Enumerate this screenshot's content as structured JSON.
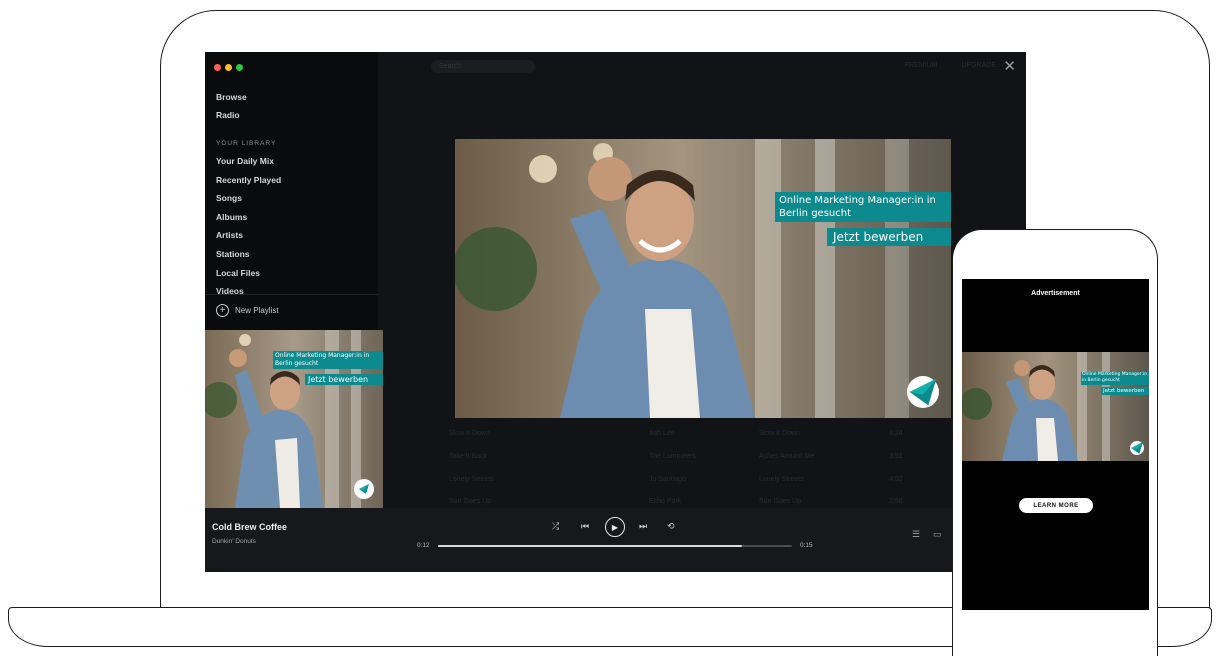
{
  "window": {
    "dots": [
      "#ff5f57",
      "#febc2e",
      "#28c840"
    ]
  },
  "topbar": {
    "search": "Search",
    "user_left": "PREMIUM",
    "user_right": "UPGRADE",
    "close_icon": "✕"
  },
  "sidebar": {
    "nav": [
      {
        "label": "Browse"
      },
      {
        "label": "Radio"
      }
    ],
    "section_label": "YOUR LIBRARY",
    "library": [
      {
        "label": "Your Daily Mix"
      },
      {
        "label": "Recently Played"
      },
      {
        "label": "Songs"
      },
      {
        "label": "Albums"
      },
      {
        "label": "Artists"
      },
      {
        "label": "Stations"
      },
      {
        "label": "Local Files"
      },
      {
        "label": "Videos"
      }
    ],
    "new_playlist": "New Playlist"
  },
  "ad": {
    "headline": "Online Marketing Manager:in in Berlin gesucht",
    "cta": "Jetzt bewerben",
    "accent": "#0d8a8e"
  },
  "tracklist": [
    {
      "title": "Slow It Down",
      "artist": "Ash Lee",
      "album": "Slow It Down",
      "time": "3:24"
    },
    {
      "title": "Take It Back",
      "artist": "The Lumineers",
      "album": "Ashes Around Me",
      "time": "3:51"
    },
    {
      "title": "Lonely Streets",
      "artist": "Jo Santiago",
      "album": "Lonely Streets",
      "time": "4:02"
    },
    {
      "title": "Sun Goes Up",
      "artist": "Echo Park",
      "album": "Sun Goes Up",
      "time": "2:58"
    }
  ],
  "player": {
    "title": "Cold Brew Coffee",
    "artist": "Dunkin' Donuts",
    "time_elapsed": "0:12",
    "time_total": "0:15",
    "progress": 0.86,
    "icons": {
      "shuffle": "⤮",
      "prev": "⏮",
      "play": "▶",
      "next": "⏭",
      "repeat": "⟲",
      "queue": "☰",
      "devices": "▭"
    }
  },
  "phone": {
    "ad_label": "Advertisement",
    "learn_more": "LEARN MORE"
  }
}
